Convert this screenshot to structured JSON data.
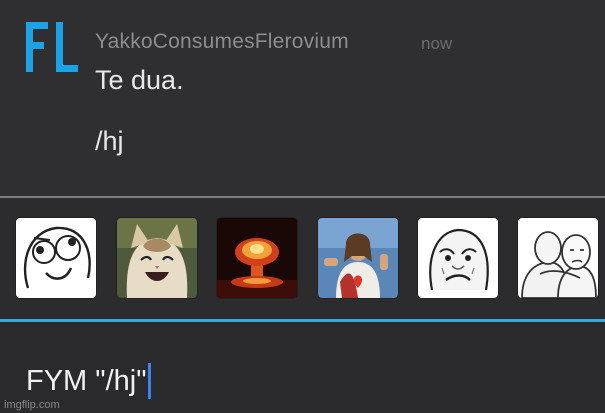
{
  "comment": {
    "avatar_text": "FL",
    "username": "YakkoConsumesFlerovium",
    "timestamp": "now",
    "message_lines": [
      "Te dua.",
      "/hj"
    ]
  },
  "stickers": [
    {
      "icon": "derp-face-sticker"
    },
    {
      "icon": "smiling-cat-sticker"
    },
    {
      "icon": "nuclear-explosion-sticker"
    },
    {
      "icon": "buddy-christ-sticker"
    },
    {
      "icon": "okay-face-sticker"
    },
    {
      "icon": "hug-wojak-sticker"
    }
  ],
  "input": {
    "value": "FYM \"/hj\""
  },
  "watermark": "imgflip.com",
  "colors": {
    "accent": "#35a8dc",
    "avatar": "#1aa3e6",
    "caret": "#3b82f6"
  }
}
